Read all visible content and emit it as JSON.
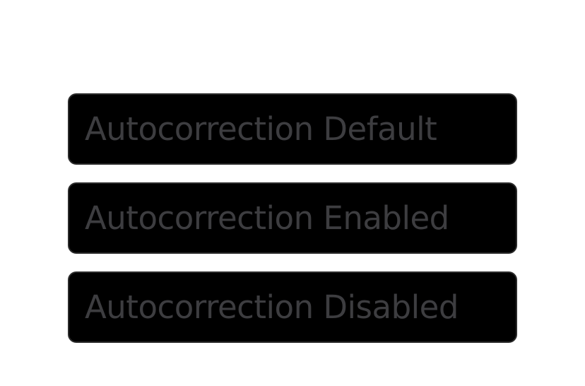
{
  "fields": [
    {
      "placeholder": "Autocorrection Default",
      "value": ""
    },
    {
      "placeholder": "Autocorrection Enabled",
      "value": ""
    },
    {
      "placeholder": "Autocorrection Disabled",
      "value": ""
    }
  ],
  "colors": {
    "background": "#ffffff",
    "field_fill": "#000000",
    "field_border": "#2b2b2b",
    "placeholder_text": "#3d3d40"
  }
}
